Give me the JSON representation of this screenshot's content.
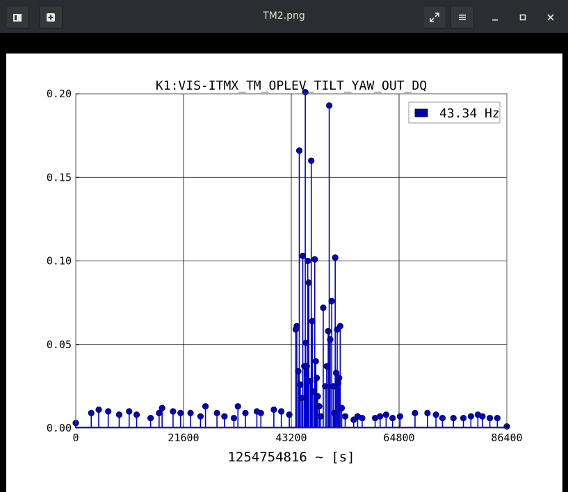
{
  "window": {
    "title": "TM2.png",
    "buttons": {
      "thumbnail_icon": "thumbnail-icon",
      "add_icon": "plus-icon",
      "fullscreen_icon": "expand-icon",
      "menu_icon": "hamburger-icon",
      "minimize_icon": "minimize-icon",
      "maximize_icon": "maximize-icon",
      "close_icon": "close-icon"
    }
  },
  "chart_data": {
    "type": "scatter",
    "title": "K1:VIS-ITMX_TM_OPLEV_TILT_YAW_OUT_DQ",
    "xlabel": "1254754816 ~ [s]",
    "ylabel": "",
    "xlim": [
      0,
      86400
    ],
    "ylim": [
      0,
      0.2
    ],
    "x_ticks": [
      0,
      21600,
      43200,
      64800,
      86400
    ],
    "y_ticks": [
      "0.00",
      "0.05",
      "0.10",
      "0.15",
      "0.20"
    ],
    "grid": true,
    "legend_position": "top-right",
    "color": "#0000cc",
    "style": "stem",
    "series": [
      {
        "name": "43.34 Hz",
        "points": [
          [
            0,
            0.003
          ],
          [
            3100,
            0.009
          ],
          [
            4600,
            0.011
          ],
          [
            6500,
            0.01
          ],
          [
            8700,
            0.008
          ],
          [
            10700,
            0.01
          ],
          [
            12200,
            0.008
          ],
          [
            15000,
            0.006
          ],
          [
            16700,
            0.009
          ],
          [
            17300,
            0.012
          ],
          [
            19500,
            0.01
          ],
          [
            21000,
            0.009
          ],
          [
            23000,
            0.009
          ],
          [
            25000,
            0.007
          ],
          [
            26000,
            0.013
          ],
          [
            28300,
            0.009
          ],
          [
            29800,
            0.007
          ],
          [
            31700,
            0.006
          ],
          [
            32500,
            0.013
          ],
          [
            34000,
            0.009
          ],
          [
            36300,
            0.01
          ],
          [
            37100,
            0.009
          ],
          [
            39700,
            0.011
          ],
          [
            41200,
            0.01
          ],
          [
            42800,
            0.008
          ],
          [
            44100,
            0.059
          ],
          [
            44300,
            0.061
          ],
          [
            44600,
            0.034
          ],
          [
            44800,
            0.166
          ],
          [
            45000,
            0.026
          ],
          [
            45300,
            0.018
          ],
          [
            45500,
            0.103
          ],
          [
            45800,
            0.037
          ],
          [
            46000,
            0.201
          ],
          [
            46100,
            0.051
          ],
          [
            46300,
            0.037
          ],
          [
            46500,
            0.1
          ],
          [
            46700,
            0.087
          ],
          [
            47000,
            0.028
          ],
          [
            47200,
            0.16
          ],
          [
            47400,
            0.064
          ],
          [
            47700,
            0.022
          ],
          [
            47900,
            0.101
          ],
          [
            48100,
            0.04
          ],
          [
            48300,
            0.03
          ],
          [
            48500,
            0.019
          ],
          [
            48800,
            0.013
          ],
          [
            49100,
            0.007
          ],
          [
            49600,
            0.072
          ],
          [
            50000,
            0.025
          ],
          [
            50300,
            0.037
          ],
          [
            50600,
            0.058
          ],
          [
            50800,
            0.193
          ],
          [
            51000,
            0.053
          ],
          [
            51300,
            0.076
          ],
          [
            51600,
            0.025
          ],
          [
            51800,
            0.009
          ],
          [
            52000,
            0.102
          ],
          [
            52200,
            0.033
          ],
          [
            52400,
            0.059
          ],
          [
            52600,
            0.027
          ],
          [
            52800,
            0.03
          ],
          [
            53000,
            0.061
          ],
          [
            53300,
            0.012
          ],
          [
            54000,
            0.007
          ],
          [
            55700,
            0.005
          ],
          [
            56500,
            0.007
          ],
          [
            57400,
            0.006
          ],
          [
            60000,
            0.006
          ],
          [
            61000,
            0.007
          ],
          [
            62200,
            0.008
          ],
          [
            63500,
            0.006
          ],
          [
            65000,
            0.007
          ],
          [
            68000,
            0.009
          ],
          [
            70500,
            0.009
          ],
          [
            72200,
            0.008
          ],
          [
            73500,
            0.006
          ],
          [
            75700,
            0.006
          ],
          [
            77700,
            0.006
          ],
          [
            79200,
            0.007
          ],
          [
            80600,
            0.008
          ],
          [
            81500,
            0.007
          ],
          [
            83000,
            0.006
          ],
          [
            84500,
            0.006
          ],
          [
            86400,
            0.001
          ]
        ]
      }
    ]
  }
}
